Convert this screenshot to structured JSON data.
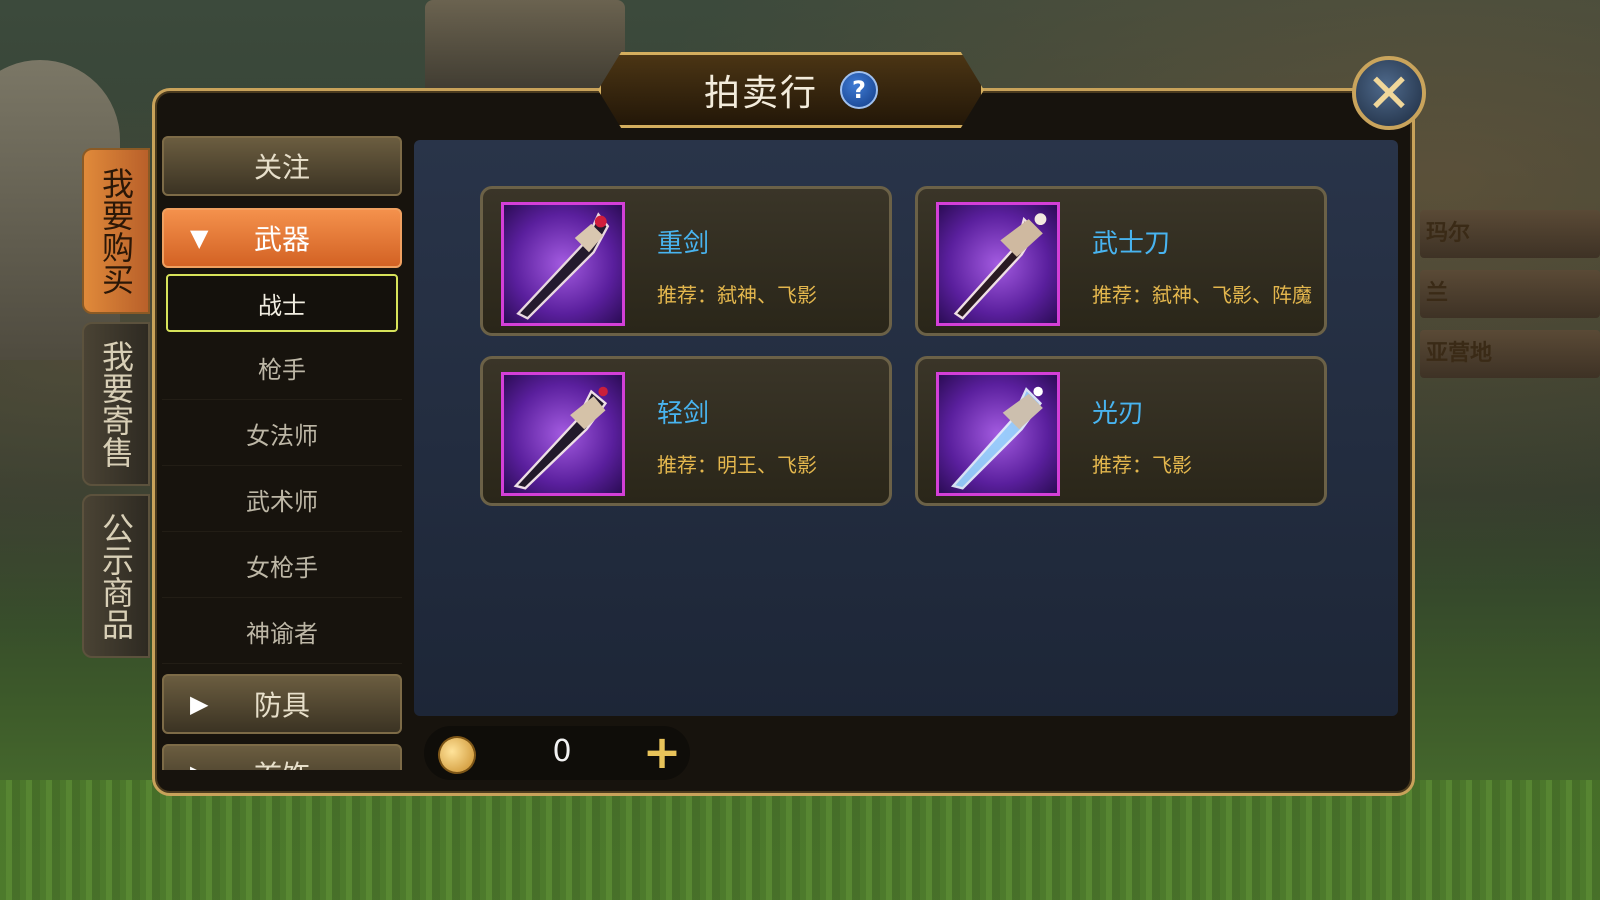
{
  "window": {
    "title": "拍卖行"
  },
  "side_tabs": [
    {
      "label": "我要购买",
      "active": true
    },
    {
      "label": "我要寄售",
      "active": false
    },
    {
      "label": "公示商品",
      "active": false
    }
  ],
  "categories": {
    "follow": "关注",
    "weapons": "武器",
    "armor": "防具",
    "accessory_partial": "首饰",
    "classes": [
      "战士",
      "枪手",
      "女法师",
      "武术师",
      "女枪手",
      "神谕者"
    ],
    "selected_class": "战士"
  },
  "items": [
    {
      "name": "重剑",
      "recommend": "推荐：弑神、飞影",
      "icon": "heavy-sword-icon"
    },
    {
      "name": "武士刀",
      "recommend": "推荐：弑神、飞影、阵魔",
      "icon": "katana-icon"
    },
    {
      "name": "轻剑",
      "recommend": "推荐：明王、飞影",
      "icon": "light-sword-icon"
    },
    {
      "name": "光刃",
      "recommend": "推荐：飞影",
      "icon": "light-blade-icon"
    }
  ],
  "currency": {
    "amount": "0",
    "icon": "coin-icon"
  },
  "background_sign": {
    "lines": [
      "玛尔",
      "兰",
      "亚营地"
    ]
  },
  "colors": {
    "accent_orange": "#f4914c",
    "item_name_blue": "#48b4f0",
    "recommend_gold": "#e3b64d",
    "frame_gold": "#c8a25a",
    "icon_border_magenta": "#d43fd8"
  }
}
